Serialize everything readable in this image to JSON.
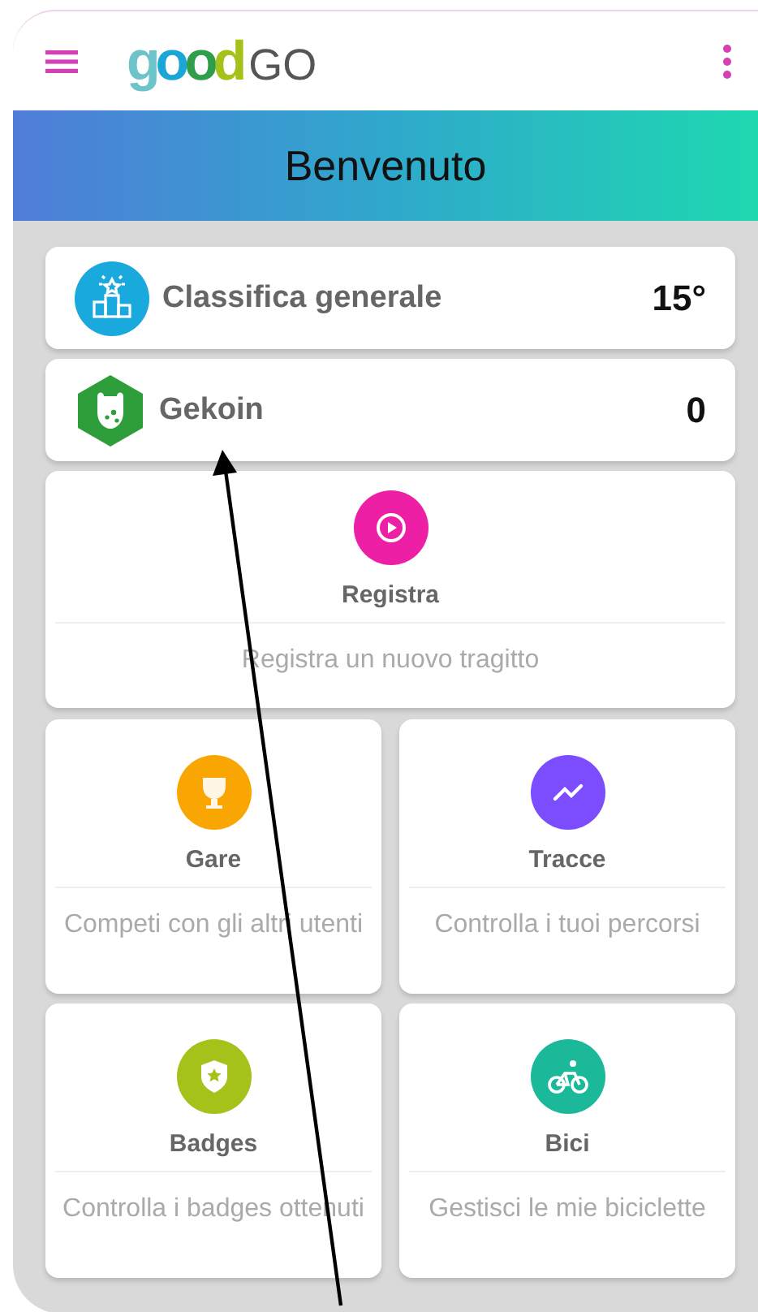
{
  "logo": {
    "mark": "good",
    "suffix": "GO"
  },
  "banner": {
    "title": "Benvenuto"
  },
  "stats": [
    {
      "kind": "ranking",
      "label": "Classifica generale",
      "value": "15°"
    },
    {
      "kind": "coin",
      "label": "Gekoin",
      "value": "0"
    }
  ],
  "actions": [
    {
      "kind": "record",
      "title": "Registra",
      "description": "Registra un nuovo tragitto",
      "color": "#ec1fa5"
    },
    {
      "kind": "races",
      "title": "Gare",
      "description": "Competi con gli altri utenti",
      "color": "#f9a602"
    },
    {
      "kind": "tracks",
      "title": "Tracce",
      "description": "Controlla i tuoi percorsi",
      "color": "#7c4dff"
    },
    {
      "kind": "badges",
      "title": "Badges",
      "description": "Controlla i badges ottenuti",
      "color": "#a5c21a"
    },
    {
      "kind": "bikes",
      "title": "Bici",
      "description": "Gestisci le mie biciclette",
      "color": "#1bb99a"
    }
  ]
}
